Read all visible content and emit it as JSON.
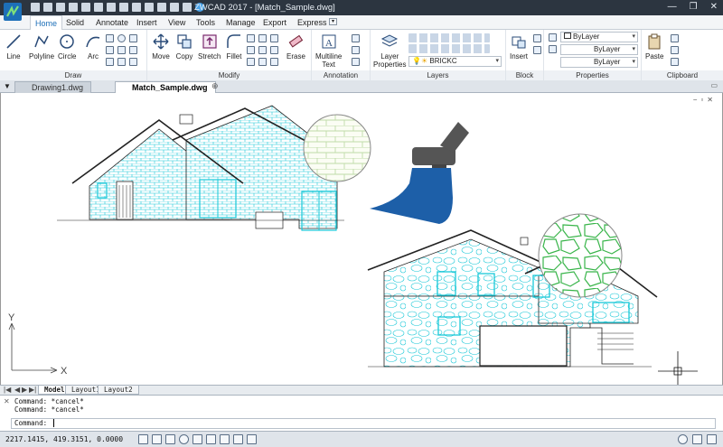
{
  "window": {
    "title": "ZWCAD 2017 - [Match_Sample.dwg]",
    "minimize": "—",
    "maximize": "❐",
    "close": "✕"
  },
  "menu": [
    "Home",
    "Solid",
    "Annotate",
    "Insert",
    "View",
    "Tools",
    "Manage",
    "Export",
    "Express"
  ],
  "ribbon": {
    "draw": {
      "title": "Draw",
      "line": "Line",
      "polyline": "Polyline",
      "circle": "Circle",
      "arc": "Arc"
    },
    "modify": {
      "title": "Modify",
      "move": "Move",
      "copy": "Copy",
      "stretch": "Stretch",
      "fillet": "Fillet",
      "erase": "Erase"
    },
    "annotation": {
      "title": "Annotation",
      "mtext_l1": "Multiline",
      "mtext_l2": "Text"
    },
    "layers": {
      "title": "Layers",
      "props_l1": "Layer",
      "props_l2": "Properties",
      "current": "BRICKC"
    },
    "block": {
      "title": "Block",
      "insert": "Insert"
    },
    "properties": {
      "title": "Properties",
      "color": "ByLayer",
      "linetype": "ByLayer",
      "lineweight": "ByLayer"
    },
    "clipboard": {
      "title": "Clipboard",
      "paste": "Paste"
    }
  },
  "doc_tabs": [
    "Drawing1.dwg",
    "Match_Sample.dwg"
  ],
  "axes": {
    "y": "Y",
    "x": "X"
  },
  "layout_tabs": [
    "Model",
    "Layout1",
    "Layout2"
  ],
  "commands": [
    "Command: *cancel*",
    "Command: *cancel*"
  ],
  "command_prompt": "Command:",
  "coords": "2217.1415,  419.3151,  0.0000",
  "colors": {
    "titlebar": "#2c3540",
    "accent": "#1d6fb8",
    "hatch_cyan": "#18c8d8",
    "brush": "#1d5fa8",
    "stone_green": "#39b54a"
  },
  "icons": [
    "line-icon",
    "polyline-icon",
    "circle-icon",
    "arc-icon",
    "move-icon",
    "copy-icon",
    "stretch-icon",
    "fillet-icon",
    "erase-icon",
    "multiline-text-icon",
    "layer-properties-icon",
    "insert-icon",
    "paste-icon",
    "match-properties-brush-icon"
  ]
}
